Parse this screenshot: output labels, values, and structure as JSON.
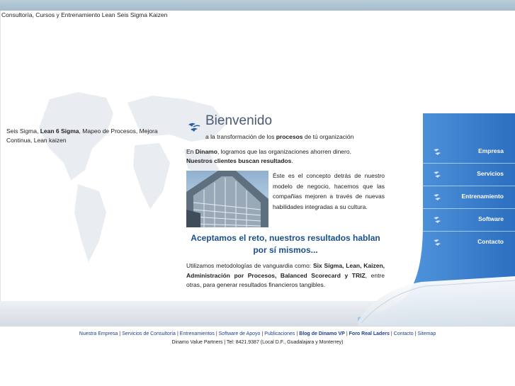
{
  "site_title": "Consultoría, Cursos y Entrenamiento Lean Seis Sigma Kaizen",
  "tagline": {
    "part1": "Seis Sigma, ",
    "bold": "Lean 6 Sigma",
    "part2": ", Mapeo de Procesos, Mejora Continua, Lean kaizen"
  },
  "welcome": {
    "title": "Bienvenido",
    "sub_prefix": "a la transformación de los ",
    "sub_bold": "procesos",
    "sub_suffix": " de tú organización"
  },
  "intro": {
    "prefix": "En ",
    "brand": "Dinamo",
    "text": ", logramos que las organizaciones ahorren dinero.",
    "bold_line": "Nuestros clientes buscan resultados",
    "end": "."
  },
  "concept": "Éste es el concepto detrás de nuestro modelo de negocio, hacemos que las compañias mejoren a través de nuevas habilidades integradas a su cultura.",
  "headline": "Aceptamos el reto, nuestros resultados hablan por sí mismos...",
  "methods": {
    "prefix": "Utilizamos metodologías de vanguardia como: ",
    "bold": "Six Sigma, Lean, Kaizen, Administración por Procesos, Balanced Scorecard y TRIZ",
    "suffix": ", entre otras, para generar resultados financieros tangibles."
  },
  "nav": [
    {
      "label": "Empresa"
    },
    {
      "label": "Servicios"
    },
    {
      "label": "Entrenamiento"
    },
    {
      "label": "Software"
    },
    {
      "label": "Contacto"
    }
  ],
  "footer": {
    "links": [
      {
        "label": "Nuestra Empresa",
        "bold": false
      },
      {
        "label": "Servicios de Consultoría",
        "bold": false
      },
      {
        "label": "Entrenamientos",
        "bold": false
      },
      {
        "label": "Software de Apoyo",
        "bold": false
      },
      {
        "label": "Publicaciones",
        "bold": false
      },
      {
        "label": "Blog de Dinamo VP",
        "bold": true
      },
      {
        "label": "Foro Real Laders",
        "bold": true
      },
      {
        "label": "Contacto",
        "bold": false
      },
      {
        "label": "Sitemap",
        "bold": false
      }
    ],
    "info": "Dinamo Value Partners | Tel: 8421.9387 (Local D.F., Guadalajara y Monterrey)"
  },
  "colors": {
    "accent": "#1b4f8c",
    "nav_panel": "#3f86d6",
    "top_bar": "#a6bccb"
  }
}
